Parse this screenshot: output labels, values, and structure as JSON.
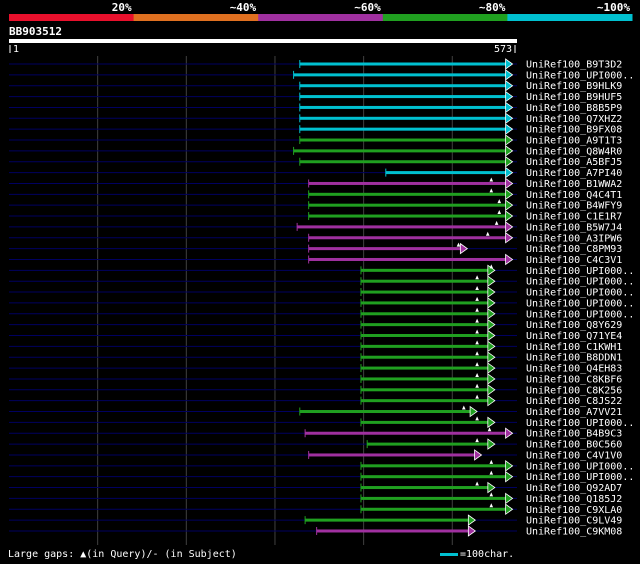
{
  "identity_scale": {
    "labels": [
      "20%",
      "~40%",
      "~60%",
      "~80%",
      "~100%"
    ],
    "colors": [
      "#e8102c",
      "#e07020",
      "#a030a0",
      "#20a020",
      "#00c0d0"
    ]
  },
  "query": {
    "id": "BB903512",
    "start_label": "1",
    "end_label": "573",
    "length": 573
  },
  "colors": {
    "background": "#000000",
    "baseline": "#000060",
    "gridline": "#404040",
    "query_bar": "#ffffff",
    "cyan": "#00c0d0",
    "green": "#20a020",
    "purple": "#a030a0",
    "gap_marker": "#ffffff",
    "arrow_outline": "#ffffff"
  },
  "hits": [
    {
      "label": "UniRef100_B9T3D2",
      "start": 328,
      "end": 568,
      "color": "cyan",
      "gap": null
    },
    {
      "label": "UniRef100_UPI000..",
      "start": 321,
      "end": 568,
      "color": "cyan",
      "gap": null
    },
    {
      "label": "UniRef100_B9HLK9",
      "start": 328,
      "end": 568,
      "color": "cyan",
      "gap": null
    },
    {
      "label": "UniRef100_B9HUF5",
      "start": 328,
      "end": 568,
      "color": "cyan",
      "gap": null
    },
    {
      "label": "UniRef100_B8B5P9",
      "start": 328,
      "end": 568,
      "color": "cyan",
      "gap": null
    },
    {
      "label": "UniRef100_Q7XHZ2",
      "start": 328,
      "end": 568,
      "color": "cyan",
      "gap": null
    },
    {
      "label": "UniRef100_B9FX08",
      "start": 328,
      "end": 568,
      "color": "cyan",
      "gap": null
    },
    {
      "label": "UniRef100_A9T1T3",
      "start": 328,
      "end": 568,
      "color": "green",
      "gap": null
    },
    {
      "label": "UniRef100_Q8W4R0",
      "start": 321,
      "end": 568,
      "color": "green",
      "gap": null
    },
    {
      "label": "UniRef100_A5BFJ5",
      "start": 328,
      "end": 568,
      "color": "green",
      "gap": null
    },
    {
      "label": "UniRef100_A7PI40",
      "start": 425,
      "end": 568,
      "color": "cyan",
      "gap": null
    },
    {
      "label": "UniRef100_B1WWA2",
      "start": 338,
      "end": 568,
      "color": "purple",
      "gap": 544
    },
    {
      "label": "UniRef100_Q4C4T1",
      "start": 338,
      "end": 568,
      "color": "green",
      "gap": 544
    },
    {
      "label": "UniRef100_B4WFY9",
      "start": 338,
      "end": 568,
      "color": "green",
      "gap": 553
    },
    {
      "label": "UniRef100_C1E1R7",
      "start": 338,
      "end": 568,
      "color": "green",
      "gap": 553
    },
    {
      "label": "UniRef100_B5W7J4",
      "start": 325,
      "end": 568,
      "color": "purple",
      "gap": 550
    },
    {
      "label": "UniRef100_A3IPW6",
      "start": 338,
      "end": 568,
      "color": "purple",
      "gap": 540
    },
    {
      "label": "UniRef100_C8PM93",
      "start": 338,
      "end": 517,
      "color": "purple",
      "gap": 507
    },
    {
      "label": "UniRef100_C4C3V1",
      "start": 338,
      "end": 568,
      "color": "purple",
      "gap": null
    },
    {
      "label": "UniRef100_UPI000..",
      "start": 397,
      "end": 548,
      "color": "green",
      "gap": 544
    },
    {
      "label": "UniRef100_UPI000..",
      "start": 397,
      "end": 548,
      "color": "green",
      "gap": 528
    },
    {
      "label": "UniRef100_UPI000..",
      "start": 397,
      "end": 548,
      "color": "green",
      "gap": 528
    },
    {
      "label": "UniRef100_UPI000..",
      "start": 397,
      "end": 548,
      "color": "green",
      "gap": 528
    },
    {
      "label": "UniRef100_UPI000..",
      "start": 397,
      "end": 548,
      "color": "green",
      "gap": 528
    },
    {
      "label": "UniRef100_Q8Y629",
      "start": 397,
      "end": 548,
      "color": "green",
      "gap": 528
    },
    {
      "label": "UniRef100_Q71YE4",
      "start": 397,
      "end": 548,
      "color": "green",
      "gap": 528
    },
    {
      "label": "UniRef100_C1KWH1",
      "start": 397,
      "end": 548,
      "color": "green",
      "gap": 528
    },
    {
      "label": "UniRef100_B8DDN1",
      "start": 397,
      "end": 548,
      "color": "green",
      "gap": 528
    },
    {
      "label": "UniRef100_Q4EH83",
      "start": 397,
      "end": 548,
      "color": "green",
      "gap": 528
    },
    {
      "label": "UniRef100_C8KBF6",
      "start": 397,
      "end": 548,
      "color": "green",
      "gap": 528
    },
    {
      "label": "UniRef100_C8K256",
      "start": 397,
      "end": 548,
      "color": "green",
      "gap": 528
    },
    {
      "label": "UniRef100_C8JS22",
      "start": 397,
      "end": 548,
      "color": "green",
      "gap": 528
    },
    {
      "label": "UniRef100_A7VV21",
      "start": 328,
      "end": 528,
      "color": "green",
      "gap": 513
    },
    {
      "label": "UniRef100_UPI000..",
      "start": 397,
      "end": 548,
      "color": "green",
      "gap": 528
    },
    {
      "label": "UniRef100_B4B9C3",
      "start": 334,
      "end": 568,
      "color": "purple",
      "gap": 542
    },
    {
      "label": "UniRef100_B0C560",
      "start": 404,
      "end": 548,
      "color": "green",
      "gap": 528
    },
    {
      "label": "UniRef100_C4V1V0",
      "start": 338,
      "end": 533,
      "color": "purple",
      "gap": null
    },
    {
      "label": "UniRef100_UPI000..",
      "start": 397,
      "end": 568,
      "color": "green",
      "gap": 544
    },
    {
      "label": "UniRef100_UPI000..",
      "start": 397,
      "end": 568,
      "color": "green",
      "gap": 544
    },
    {
      "label": "UniRef100_Q92AD7",
      "start": 397,
      "end": 548,
      "color": "green",
      "gap": 528
    },
    {
      "label": "UniRef100_Q185J2",
      "start": 397,
      "end": 568,
      "color": "green",
      "gap": 544
    },
    {
      "label": "UniRef100_C9XLA0",
      "start": 397,
      "end": 568,
      "color": "green",
      "gap": 544
    },
    {
      "label": "UniRef100_C9LV49",
      "start": 334,
      "end": 526,
      "color": "green",
      "gap": null
    },
    {
      "label": "UniRef100_C9KM08",
      "start": 347,
      "end": 526,
      "color": "purple",
      "gap": null
    }
  ],
  "legend": {
    "gaps_text": "Large gaps: ▲(in Query)/- (in Subject)",
    "scale_text": "=100char."
  }
}
